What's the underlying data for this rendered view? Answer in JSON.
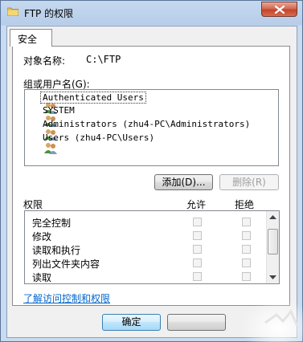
{
  "window": {
    "title": "FTP 的权限",
    "icon": "folder-icon",
    "close_icon": "close-icon"
  },
  "tabs": [
    {
      "label": "安全"
    }
  ],
  "object_name": {
    "label": "对象名称:",
    "value": "C:\\FTP"
  },
  "users": {
    "label": "组或用户名(G):",
    "items": [
      {
        "name": "Authenticated Users",
        "icon": "users-group-icon",
        "selected": true
      },
      {
        "name": "SYSTEM",
        "icon": "users-group-icon"
      },
      {
        "name": "Administrators (zhu4-PC\\Administrators)",
        "icon": "users-group-icon"
      },
      {
        "name": "Users (zhu4-PC\\Users)",
        "icon": "users-group-icon"
      }
    ],
    "add_button": "添加(D)...",
    "remove_button": "删除(R)"
  },
  "permissions": {
    "label": "权限",
    "allow_header": "允许",
    "deny_header": "拒绝",
    "rows": [
      {
        "name": "完全控制",
        "allow": false,
        "deny": false
      },
      {
        "name": "修改",
        "allow": false,
        "deny": false
      },
      {
        "name": "读取和执行",
        "allow": false,
        "deny": false
      },
      {
        "name": "列出文件夹内容",
        "allow": false,
        "deny": false
      },
      {
        "name": "读取",
        "allow": false,
        "deny": false
      }
    ]
  },
  "help_link": "了解访问控制和权限",
  "buttons": {
    "ok": "确定"
  },
  "colors": {
    "link": "#0066cc",
    "close_red": "#c4442b",
    "title_bar": "#b9d1ea"
  }
}
